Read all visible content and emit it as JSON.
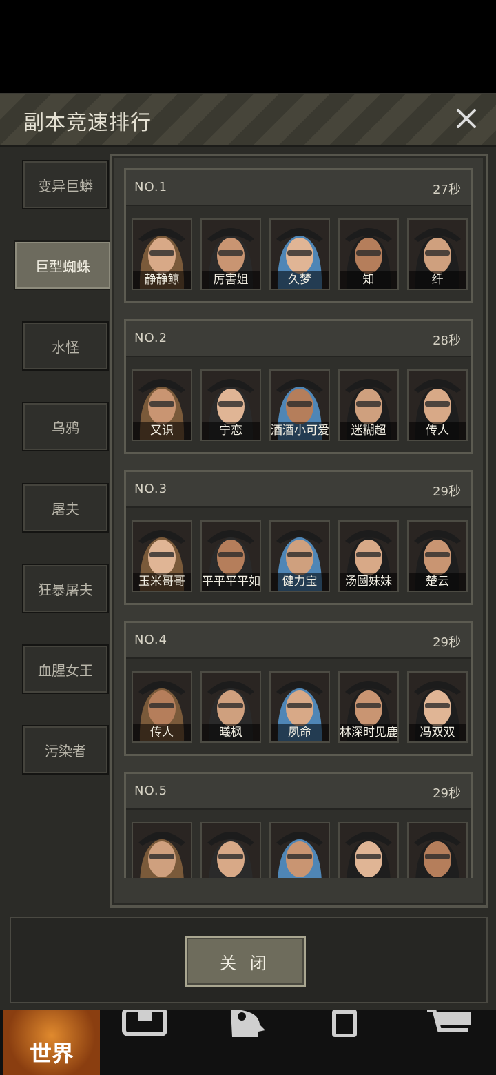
{
  "dialog": {
    "title": "副本竞速排行",
    "close_button_label": "关 闭"
  },
  "sidebar": {
    "items": [
      {
        "label": "变异巨蟒",
        "active": false
      },
      {
        "label": "巨型蜘蛛",
        "active": true
      },
      {
        "label": "水怪",
        "active": false
      },
      {
        "label": "乌鸦",
        "active": false
      },
      {
        "label": "屠夫",
        "active": false
      },
      {
        "label": "狂暴屠夫",
        "active": false
      },
      {
        "label": "血腥女王",
        "active": false
      },
      {
        "label": "污染者",
        "active": false
      }
    ]
  },
  "rankings": [
    {
      "rank": "NO.1",
      "time": "27秒",
      "players": [
        {
          "name": "静静鲸",
          "icon": "avatar-bunny-ears-goggles"
        },
        {
          "name": "厉害姐",
          "icon": "avatar-wide-hat"
        },
        {
          "name": "久梦",
          "icon": "avatar-bunny-ears-blue-hair"
        },
        {
          "name": "知",
          "icon": "avatar-pirate-hat-glasses"
        },
        {
          "name": "纤",
          "icon": "avatar-wide-hat-glasses"
        }
      ]
    },
    {
      "rank": "NO.2",
      "time": "28秒",
      "players": [
        {
          "name": "又识",
          "icon": "avatar-officer-cap"
        },
        {
          "name": "宁恋",
          "icon": "avatar-bunny-ears-eyepatch"
        },
        {
          "name": "酒酒小可爱",
          "icon": "avatar-goggles-mask"
        },
        {
          "name": "迷糊超",
          "icon": "avatar-officer-cap-mask"
        },
        {
          "name": "传人",
          "icon": "avatar-motorcycle-helmet"
        }
      ]
    },
    {
      "rank": "NO.3",
      "time": "29秒",
      "players": [
        {
          "name": "玉米哥哥",
          "icon": "avatar-wide-hat-mask"
        },
        {
          "name": "平平平平如",
          "icon": "avatar-bunny-ears-purple-hair"
        },
        {
          "name": "健力宝",
          "icon": "avatar-bunny-ears-eyepatch-male"
        },
        {
          "name": "汤圆妹妹",
          "icon": "avatar-wide-hat"
        },
        {
          "name": "楚云",
          "icon": "avatar-wide-hat-eyepatch"
        }
      ]
    },
    {
      "rank": "NO.4",
      "time": "29秒",
      "players": [
        {
          "name": "传人",
          "icon": "avatar-motorcycle-helmet"
        },
        {
          "name": "曦枫",
          "icon": "avatar-bunny-ears-blue-hair"
        },
        {
          "name": "夙命",
          "icon": "avatar-panda-hood"
        },
        {
          "name": "林深时见鹿",
          "icon": "avatar-brown-hair"
        },
        {
          "name": "冯双双",
          "icon": "avatar-visor-helmet"
        }
      ]
    },
    {
      "rank": "NO.5",
      "time": "29秒",
      "players": [
        {
          "name": "",
          "icon": "avatar-wide-hat"
        },
        {
          "name": "",
          "icon": "avatar-wide-hat-beard"
        },
        {
          "name": "",
          "icon": "avatar-pirate-hat"
        },
        {
          "name": "",
          "icon": "avatar-bunny-ears-goggles-male"
        },
        {
          "name": "",
          "icon": "avatar-wide-hat-eyepatch-beard"
        }
      ]
    }
  ],
  "bottom_nav": {
    "world_label": "世界",
    "items": [
      "world-globe-icon",
      "backpack-icon",
      "skills-head-icon",
      "phone-icon",
      "shop-cart-icon"
    ]
  },
  "colors": {
    "hair": [
      "#7a5a3a",
      "#2a2a2a",
      "#4f86b6",
      "#1e1e1e",
      "#1e1e1e"
    ]
  }
}
